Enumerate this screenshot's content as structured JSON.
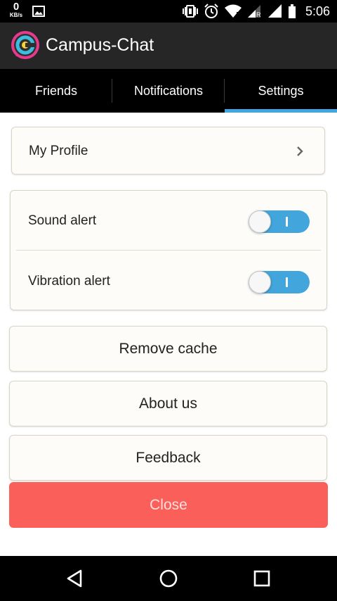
{
  "status_bar": {
    "net_speed_value": "0",
    "net_speed_unit": "KB/s",
    "time": "5:06",
    "icons": [
      "image-icon",
      "vibrate-icon",
      "alarm-icon",
      "wifi-icon",
      "signal-icon",
      "signal-icon",
      "battery-icon"
    ]
  },
  "app": {
    "title": "Campus-Chat",
    "logo_icon": "campus-chat-logo",
    "colors": {
      "app_bar": "#262626",
      "accent": "#42a6dc",
      "close": "#fa5f5a"
    }
  },
  "tabs": [
    {
      "label": "Friends",
      "active": false
    },
    {
      "label": "Notifications",
      "active": false
    },
    {
      "label": "Settings",
      "active": true
    }
  ],
  "settings": {
    "profile": {
      "label": "My Profile",
      "icon": "chevron-right-icon"
    },
    "alerts": [
      {
        "label": "Sound alert",
        "enabled": true
      },
      {
        "label": "Vibration alert",
        "enabled": true
      }
    ],
    "buttons": {
      "remove_cache": "Remove cache",
      "about_us": "About us",
      "feedback": "Feedback",
      "close": "Close"
    }
  },
  "nav_bar": {
    "icons": [
      "back-icon",
      "home-icon",
      "recents-icon"
    ]
  }
}
